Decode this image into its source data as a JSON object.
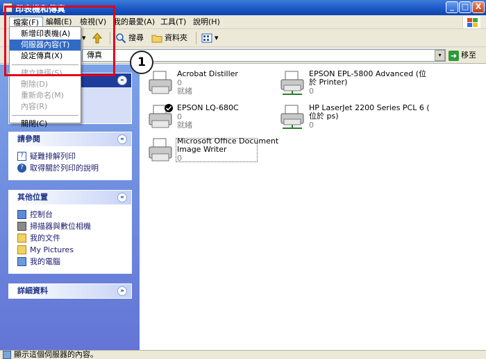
{
  "window": {
    "title": "印表機和傳真",
    "minimize": "_",
    "maximize": "□",
    "close": "X"
  },
  "menu": [
    {
      "label": "檔案(F)"
    },
    {
      "label": "編輯(E)"
    },
    {
      "label": "檢視(V)"
    },
    {
      "label": "我的最愛(A)"
    },
    {
      "label": "工具(T)"
    },
    {
      "label": "說明(H)"
    }
  ],
  "toolbar": {
    "search": "搜尋",
    "folders": "資料夾",
    "view_caret": "▾"
  },
  "address": {
    "value": "傳真",
    "go": "移至",
    "dropdown": "▾",
    "go_arrow": "➜"
  },
  "file_menu": {
    "items": [
      {
        "label": "新增印表機(A)",
        "state": "normal"
      },
      {
        "label": "伺服器內容(T)",
        "state": "highlighted"
      },
      {
        "label": "設定傳真(X)",
        "state": "normal"
      },
      {
        "label": "建立捷徑(S)",
        "state": "disabled"
      },
      {
        "label": "刪除(D)",
        "state": "disabled"
      },
      {
        "label": "重新命名(M)",
        "state": "disabled"
      },
      {
        "label": "內容(R)",
        "state": "disabled"
      },
      {
        "label": "關閉(C)",
        "state": "normal"
      }
    ]
  },
  "panes": {
    "tasks": {
      "toggle": "«"
    },
    "see_also": {
      "title": "請參閱",
      "toggle": "«",
      "items": [
        {
          "label": "疑難排解列印"
        },
        {
          "label": "取得關於列印的說明"
        }
      ]
    },
    "other_places": {
      "title": "其他位置",
      "toggle": "«",
      "items": [
        {
          "label": "控制台"
        },
        {
          "label": "掃描器與數位相機"
        },
        {
          "label": "我的文件"
        },
        {
          "label": "My Pictures"
        },
        {
          "label": "我的電腦"
        }
      ]
    },
    "details": {
      "title": "詳細資料",
      "toggle": "»"
    }
  },
  "printers": [
    {
      "name": "Acrobat Distiller",
      "count": "0",
      "status": "就緒"
    },
    {
      "name": "EPSON EPL-5800 Advanced (位",
      "name2": "於 Printer)",
      "count": "0",
      "status": ""
    },
    {
      "name": "EPSON LQ-680C",
      "count": "0",
      "status": "就緒"
    },
    {
      "name": "HP LaserJet 2200 Series PCL 6 (",
      "name2": "位於 ps)",
      "count": "0",
      "status": ""
    },
    {
      "name": "Microsoft Office Document",
      "name2": "Image Writer",
      "count": "0",
      "status": ""
    }
  ],
  "statusbar": {
    "text": "顯示這個伺服器的內容。"
  },
  "annotation": {
    "step": "1"
  }
}
